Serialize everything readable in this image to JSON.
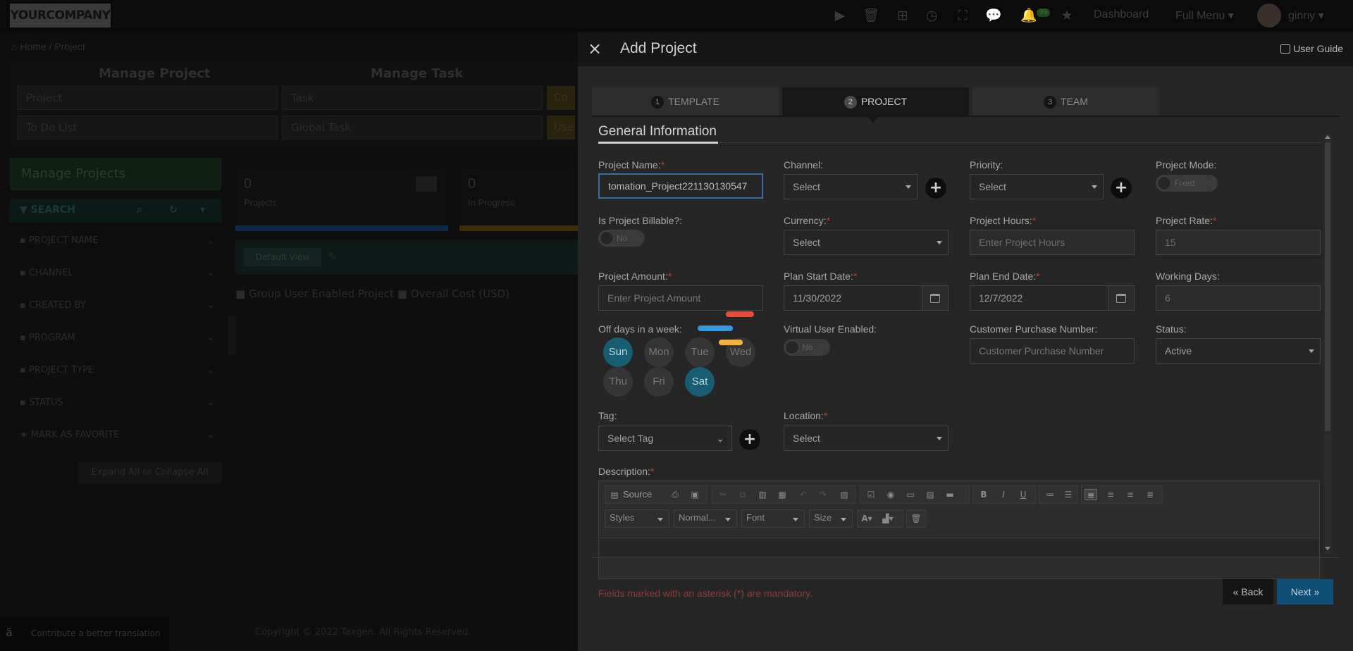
{
  "app": {
    "logo_text": "YOURCOMPANY",
    "nav": {
      "dashboard": "Dashboard",
      "full_menu": "Full Menu",
      "user": "ginny",
      "notification_count": "99"
    }
  },
  "background": {
    "breadcrumb": "Home / Project",
    "manage_project_header": "Manage Project",
    "manage_task_header": "Manage Task",
    "cells": [
      "Project",
      "To Do List",
      "Task",
      "Global Task"
    ],
    "gold_cells": [
      "Co",
      "Use"
    ],
    "manage_projects": "Manage Projects",
    "search_label": "SEARCH",
    "filters": [
      "PROJECT NAME",
      "CHANNEL",
      "CREATED BY",
      "PROGRAM",
      "PROJECT TYPE",
      "STATUS",
      "MARK AS FAVORITE"
    ],
    "reset_button": "Expand All or Collapse All",
    "stats": [
      {
        "count": "0",
        "label": "Projects"
      },
      {
        "count": "0",
        "label": "In Progress"
      }
    ],
    "default_view": "Default View",
    "legend": "Group User Enabled Project",
    "legend2": "Overall Cost (USD)",
    "footer_left": "Contribute a better translation",
    "copyright": "Copyright © 2022 Taxgen. All Rights Reserved."
  },
  "modal": {
    "title": "Add Project",
    "user_guide": "User Guide",
    "tabs": [
      {
        "num": "1",
        "label": "TEMPLATE"
      },
      {
        "num": "2",
        "label": "PROJECT"
      },
      {
        "num": "3",
        "label": "TEAM"
      }
    ],
    "section_title": "General Information",
    "fields": {
      "project_name": {
        "label": "Project Name:",
        "value": "tomation_Project221130130547"
      },
      "channel": {
        "label": "Channel:",
        "value": "Select"
      },
      "priority": {
        "label": "Priority:",
        "value": "Select"
      },
      "project_mode": {
        "label": "Project Mode:",
        "value": "Fixed"
      },
      "billable": {
        "label": "Is Project Billable?:",
        "value": "No"
      },
      "currency": {
        "label": "Currency:",
        "value": "Select"
      },
      "project_hours": {
        "label": "Project Hours:",
        "placeholder": "Enter Project Hours"
      },
      "project_rate": {
        "label": "Project Rate:",
        "value": "15"
      },
      "project_amount": {
        "label": "Project Amount:",
        "placeholder": "Enter Project Amount"
      },
      "plan_start": {
        "label": "Plan Start Date:",
        "value": "11/30/2022"
      },
      "plan_end": {
        "label": "Plan End Date:",
        "value": "12/7/2022"
      },
      "working_days": {
        "label": "Working Days:",
        "value": "6"
      },
      "off_days": {
        "label": "Off days in a week:"
      },
      "virtual_user": {
        "label": "Virtual User Enabled:",
        "value": "No"
      },
      "customer_po": {
        "label": "Customer Purchase Number:",
        "placeholder": "Customer Purchase Number"
      },
      "status": {
        "label": "Status:",
        "value": "Active"
      },
      "tag": {
        "label": "Tag:",
        "value": "Select Tag"
      },
      "location": {
        "label": "Location:",
        "value": "Select"
      },
      "description": {
        "label": "Description:"
      }
    },
    "days": [
      {
        "label": "Sun",
        "selected": true
      },
      {
        "label": "Mon",
        "selected": false
      },
      {
        "label": "Tue",
        "selected": false
      },
      {
        "label": "Wed",
        "selected": false
      },
      {
        "label": "Thu",
        "selected": false
      },
      {
        "label": "Fri",
        "selected": false
      },
      {
        "label": "Sat",
        "selected": true
      }
    ],
    "editor": {
      "source_label": "Source",
      "styles": "Styles",
      "format": "Normal...",
      "font": "Font",
      "size": "Size"
    },
    "mandatory_note": "Fields marked with an asterisk (*) are mandatory.",
    "back_button": "« Back",
    "next_button": "Next »"
  },
  "colors": {
    "accent": "#0f4e75",
    "day_selected": "#175e73",
    "loader_red": "#e74c3c",
    "loader_blue": "#3498db",
    "loader_orange": "#f5b041"
  }
}
